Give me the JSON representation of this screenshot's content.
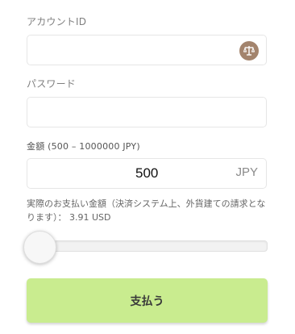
{
  "form": {
    "account_label": "アカウントID",
    "account_value": "",
    "password_label": "パスワード",
    "password_value": "",
    "amount_label": "金額 (500 – 1000000 JPY)",
    "amount_value": "500",
    "currency": "JPY",
    "note": "実際のお支払い金額（決済システム上、外貨建ての請求となります）： 3.91 USD",
    "slider_level": 0,
    "pay_label": "支払う"
  },
  "colors": {
    "badge": "#a3846d",
    "button": "#c9ec8f"
  },
  "icons": {
    "account_badge": "scale-icon"
  }
}
